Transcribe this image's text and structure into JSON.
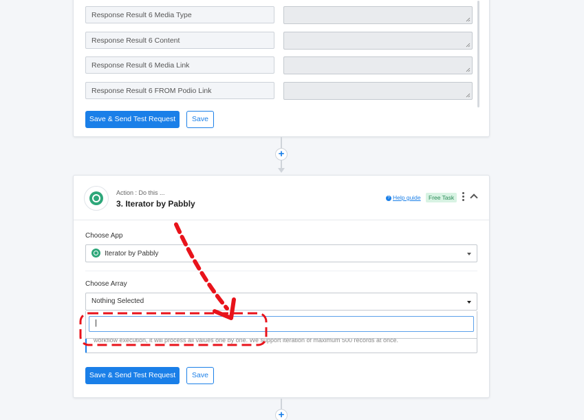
{
  "step_top": {
    "fields": [
      {
        "label": "Response Result 6 Media Type"
      },
      {
        "label": "Response Result 6 Content"
      },
      {
        "label": "Response Result 6 Media Link"
      },
      {
        "label": "Response Result 6 FROM Podio Link"
      }
    ],
    "save_send_label": "Save & Send Test Request",
    "save_label": "Save"
  },
  "connector": {
    "plus_symbol": "+"
  },
  "step_iterator": {
    "action_sub": "Action : Do this ...",
    "title": "3. Iterator by Pabbly",
    "help_icon_glyph": "?",
    "help_label": "Help guide",
    "badge": "Free Task",
    "choose_app_label": "Choose App",
    "app_value": "Iterator by Pabbly",
    "choose_array_label": "Choose Array",
    "array_value": "Nothing Selected",
    "search_value": "|",
    "hint_text": "workflow execution, it will process all values one by one. We support iteration of maximum 500 records at once.",
    "save_send_label": "Save & Send Test Request",
    "save_label": "Save"
  },
  "colors": {
    "accent": "#1a7fe8",
    "iterator_brand": "#2ea77a",
    "annotation": "#e8131b"
  }
}
